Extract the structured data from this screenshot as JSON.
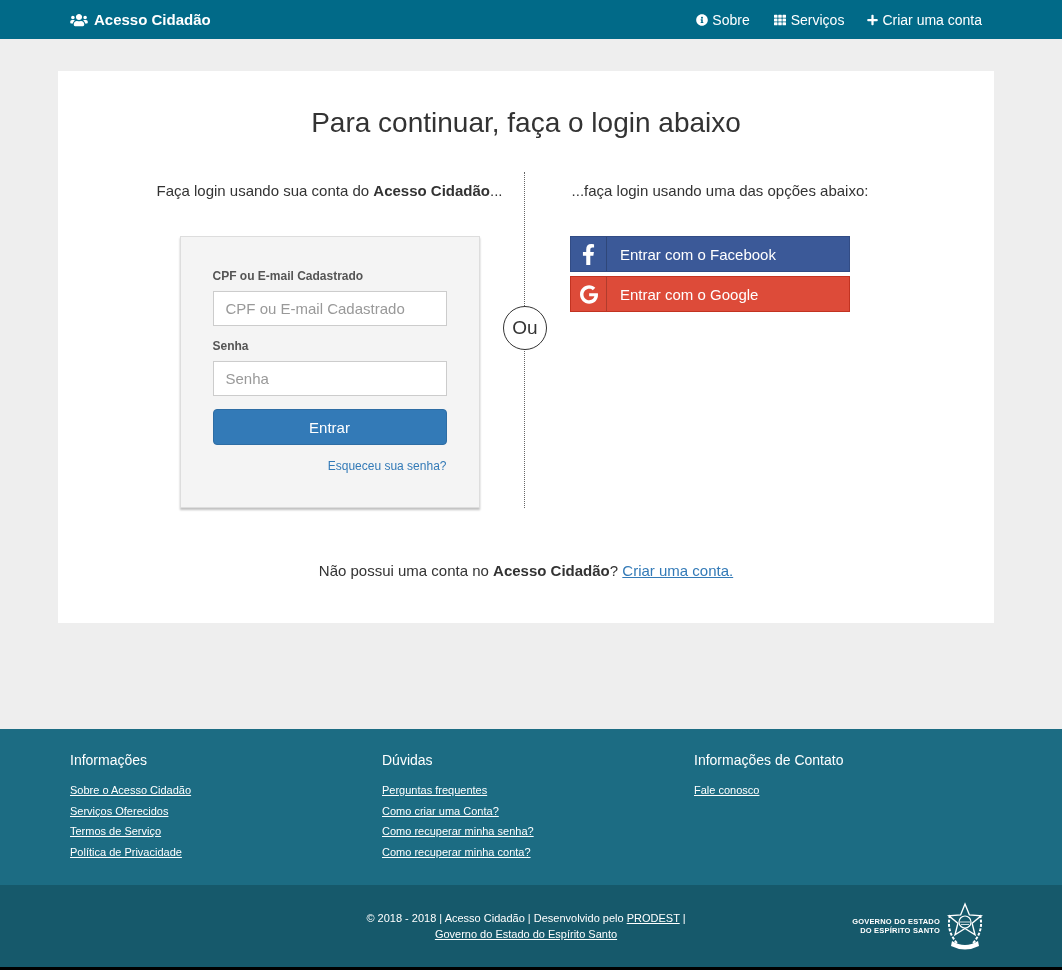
{
  "navbar": {
    "brand": "Acesso Cidadão",
    "links": [
      {
        "label": "Sobre",
        "kind": "info"
      },
      {
        "label": "Serviços",
        "kind": "grid"
      },
      {
        "label": "Criar uma conta",
        "kind": "plus"
      }
    ]
  },
  "login": {
    "title": "Para continuar, faça o login abaixo",
    "local_intro": "Faça login usando sua conta do **Acesso Cidadão**...",
    "form": {
      "fields": [
        {
          "label": "CPF ou E-mail Cadastrado",
          "placeholder": "CPF ou E-mail Cadastrado"
        },
        {
          "label": "Senha",
          "placeholder": "Senha"
        }
      ],
      "submit": "Entrar",
      "forgot_link": "Esqueceu sua senha?"
    },
    "separator": "Ou",
    "social_intro": "...faça login usando uma das opções abaixo:",
    "social_buttons": [
      {
        "label": "Entrar com o Facebook",
        "kind": "facebook"
      },
      {
        "label": "Entrar com o Google",
        "kind": "google"
      }
    ],
    "signup_prompt": "Não possui uma conta no **Acesso Cidadão**?",
    "signup_link": "Criar uma conta."
  },
  "footer": {
    "columns": [
      {
        "title": "Informações",
        "links": [
          "Sobre o Acesso Cidadão",
          "Serviços Oferecidos",
          "Termos de Serviço",
          "Política de Privacidade"
        ]
      },
      {
        "title": "Dúvidas",
        "links": [
          "Perguntas frequentes",
          "Como criar uma Conta?",
          "Como recuperar minha senha?",
          "Como recuperar minha conta?"
        ]
      },
      {
        "title": "Informações de Contato",
        "links": [
          "Fale conosco"
        ]
      }
    ]
  },
  "bottom_bar": {
    "copyright": "© 2018 - 2018 | Acesso Cidadão | Desenvolvido pelo",
    "developer_link": "PRODEST",
    "separator": "|",
    "government_link": "Governo do Estado do Espírito Santo",
    "logo_lines": [
      "GOVERNO DO ESTADO",
      "DO ESPÍRITO SANTO"
    ]
  }
}
